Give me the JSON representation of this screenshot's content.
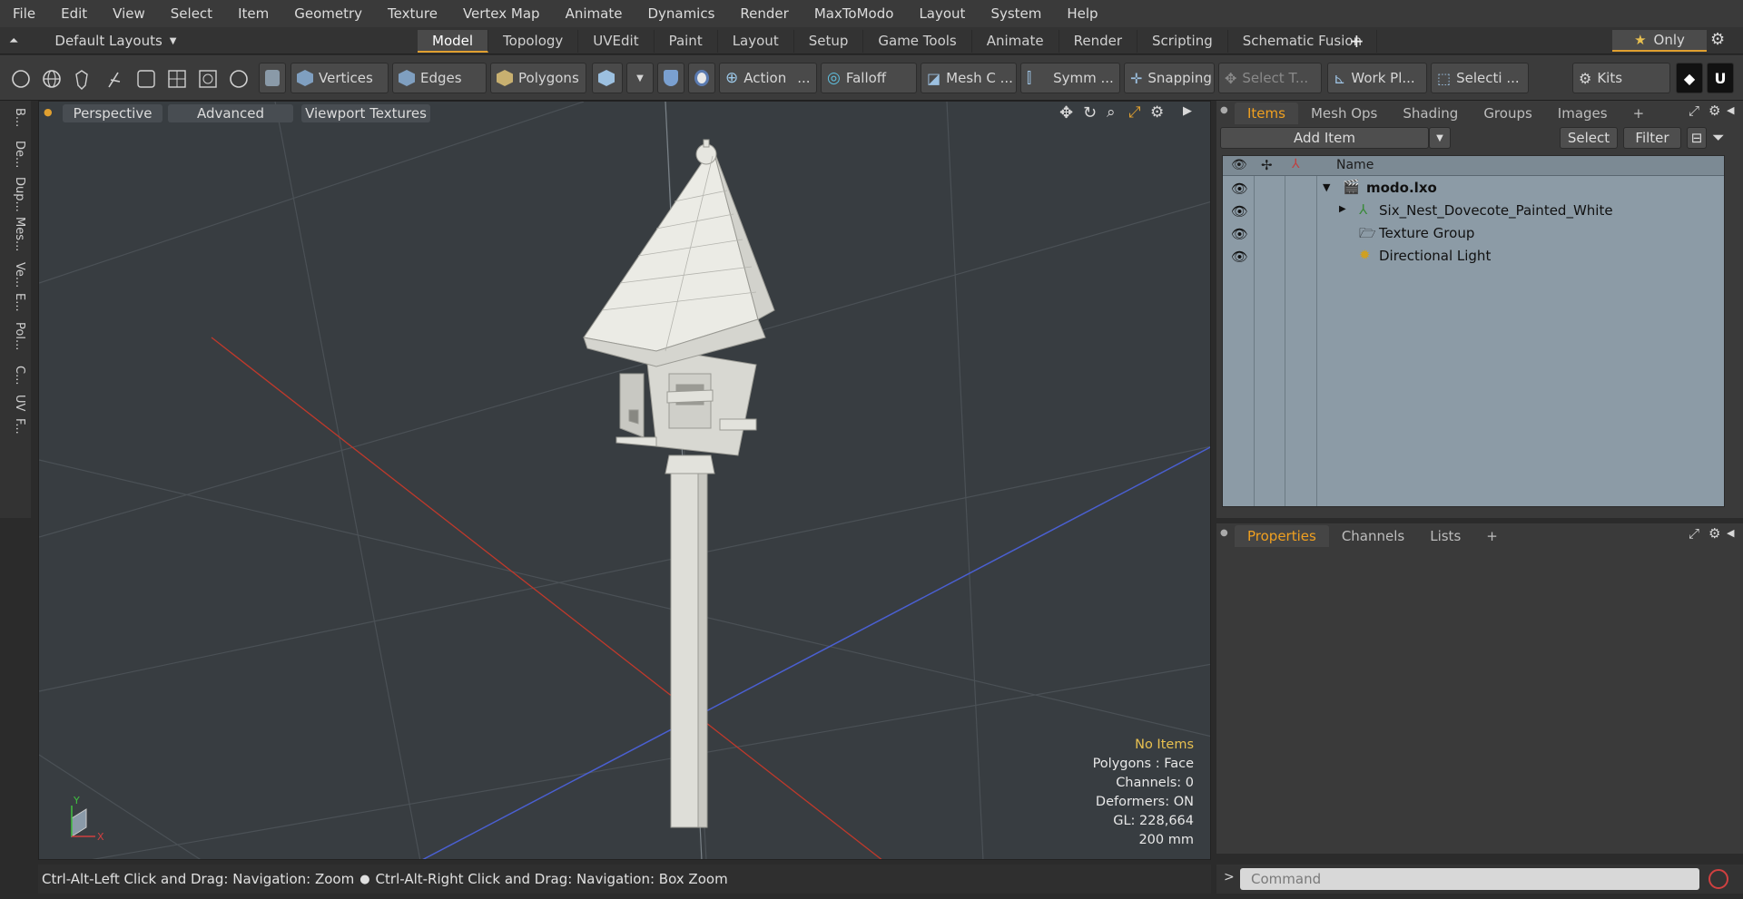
{
  "menu": [
    "File",
    "Edit",
    "View",
    "Select",
    "Item",
    "Geometry",
    "Texture",
    "Vertex Map",
    "Animate",
    "Dynamics",
    "Render",
    "MaxToModo",
    "Layout",
    "System",
    "Help"
  ],
  "layout_selector": "Default Layouts",
  "layout_tabs": [
    {
      "label": "Model",
      "active": true
    },
    {
      "label": "Topology",
      "active": false
    },
    {
      "label": "UVEdit",
      "active": false
    },
    {
      "label": "Paint",
      "active": false
    },
    {
      "label": "Layout",
      "active": false
    },
    {
      "label": "Setup",
      "active": false
    },
    {
      "label": "Game Tools",
      "active": false
    },
    {
      "label": "Animate",
      "active": false
    },
    {
      "label": "Render",
      "active": false
    },
    {
      "label": "Scripting",
      "active": false
    },
    {
      "label": "Schematic Fusion",
      "active": false
    }
  ],
  "only_label": "Only",
  "toolbar": {
    "vertices": "Vertices",
    "edges": "Edges",
    "polygons": "Polygons",
    "action": "Action",
    "action_more": "...",
    "falloff": "Falloff",
    "mesh": "Mesh C ...",
    "symmetry": "Symm ...",
    "snapping": "Snapping",
    "select_t": "Select T...",
    "work_plane": "Work Pl...",
    "selection": "Selecti ...",
    "kits": "Kits"
  },
  "left_tabs": [
    "B...",
    "De...",
    "Dup...",
    "Mes...",
    "Ve...",
    "E...",
    "Pol...",
    "C...",
    "UV",
    "F..."
  ],
  "viewport": {
    "perspective": "Perspective",
    "advanced": "Advanced",
    "viewport_textures": "Viewport Textures",
    "axis_y": "Y",
    "axis_x": "X",
    "info": {
      "no_items": "No Items",
      "polygons": "Polygons : Face",
      "channels": "Channels: 0",
      "deformers": "Deformers: ON",
      "gl": "GL: 228,664",
      "scale": "200 mm"
    }
  },
  "status_bar": {
    "left": "Ctrl-Alt-Left Click and Drag: Navigation: Zoom",
    "right": "Ctrl-Alt-Right Click and Drag: Navigation: Box Zoom"
  },
  "items_panel": {
    "tabs": [
      {
        "label": "Items",
        "active": true
      },
      {
        "label": "Mesh Ops",
        "active": false
      },
      {
        "label": "Shading",
        "active": false
      },
      {
        "label": "Groups",
        "active": false
      },
      {
        "label": "Images",
        "active": false
      }
    ],
    "add_item": "Add Item",
    "select": "Select",
    "filter": "Filter",
    "column_name": "Name",
    "tree": [
      {
        "label": "modo.lxo",
        "level": 0,
        "bold": true
      },
      {
        "label": "Six_Nest_Dovecote_Painted_White",
        "level": 1,
        "bold": false
      },
      {
        "label": "Texture Group",
        "level": 1,
        "bold": false
      },
      {
        "label": "Directional Light",
        "level": 1,
        "bold": false
      }
    ]
  },
  "properties_panel": {
    "tabs": [
      {
        "label": "Properties",
        "active": true
      },
      {
        "label": "Channels",
        "active": false
      },
      {
        "label": "Lists",
        "active": false
      }
    ]
  },
  "command": {
    "placeholder": "Command",
    "prompt": ">"
  },
  "colors": {
    "accent": "#e0a030",
    "x_axis": "#c0392b",
    "z_axis": "#4a5fd0",
    "tree_bg": "#8c9ba6"
  }
}
